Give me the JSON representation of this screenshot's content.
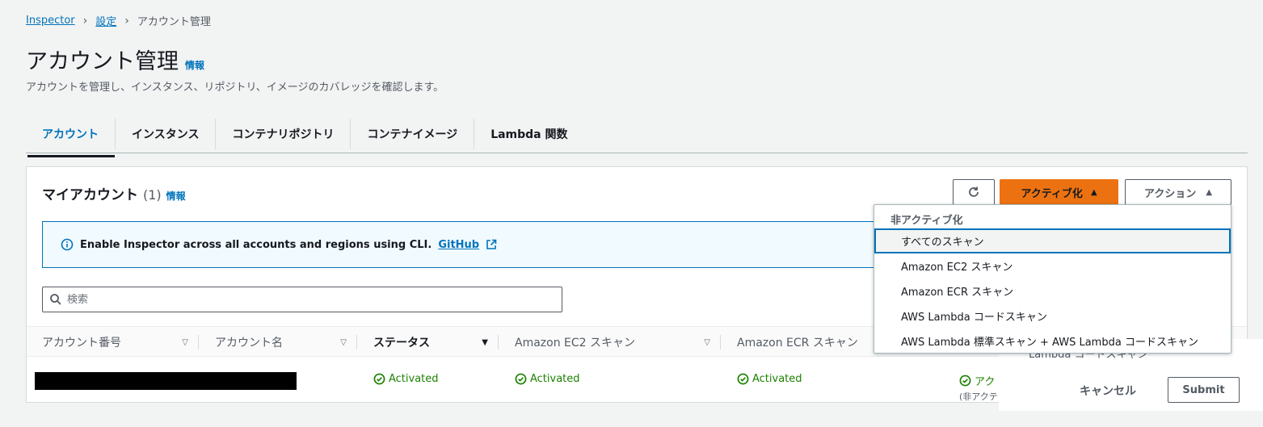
{
  "breadcrumb": {
    "root": "Inspector",
    "settings": "設定",
    "current": "アカウント管理"
  },
  "page": {
    "title": "アカウント管理",
    "info": "情報",
    "description": "アカウントを管理し、インスタンス、リポジトリ、イメージのカバレッジを確認します。"
  },
  "tabs": [
    "アカウント",
    "インスタンス",
    "コンテナリポジトリ",
    "コンテナイメージ",
    "Lambda 関数"
  ],
  "panel": {
    "title": "マイアカウント",
    "count": "(1)",
    "info": "情報",
    "activate_label": "アクティブ化",
    "action_label": "アクション"
  },
  "alert": {
    "text": "Enable Inspector across all accounts and regions using CLI.",
    "link": "GitHub"
  },
  "search": {
    "placeholder": "検索"
  },
  "table": {
    "headers": [
      "アカウント番号",
      "アカウント名",
      "ステータス",
      "Amazon EC2 スキャン",
      "Amazon ECR スキャン"
    ],
    "row": {
      "status": "Activated",
      "ec2": "Activated",
      "ecr": "Activated",
      "lambda": "アク",
      "lambda_sub": "(非アクテ"
    }
  },
  "dropdown": {
    "group": "非アクティブ化",
    "items": [
      "すべてのスキャン",
      "Amazon EC2 スキャン",
      "Amazon ECR スキャン",
      "AWS Lambda コードスキャン",
      "AWS Lambda 標準スキャン + AWS Lambda コードスキャン"
    ]
  },
  "modal": {
    "ghost": "Lambda コードスキャン",
    "cancel": "キャンセル",
    "submit": "Submit"
  },
  "colors": {
    "accent": "#ec7211",
    "link": "#0073bb",
    "success": "#1d8102"
  }
}
